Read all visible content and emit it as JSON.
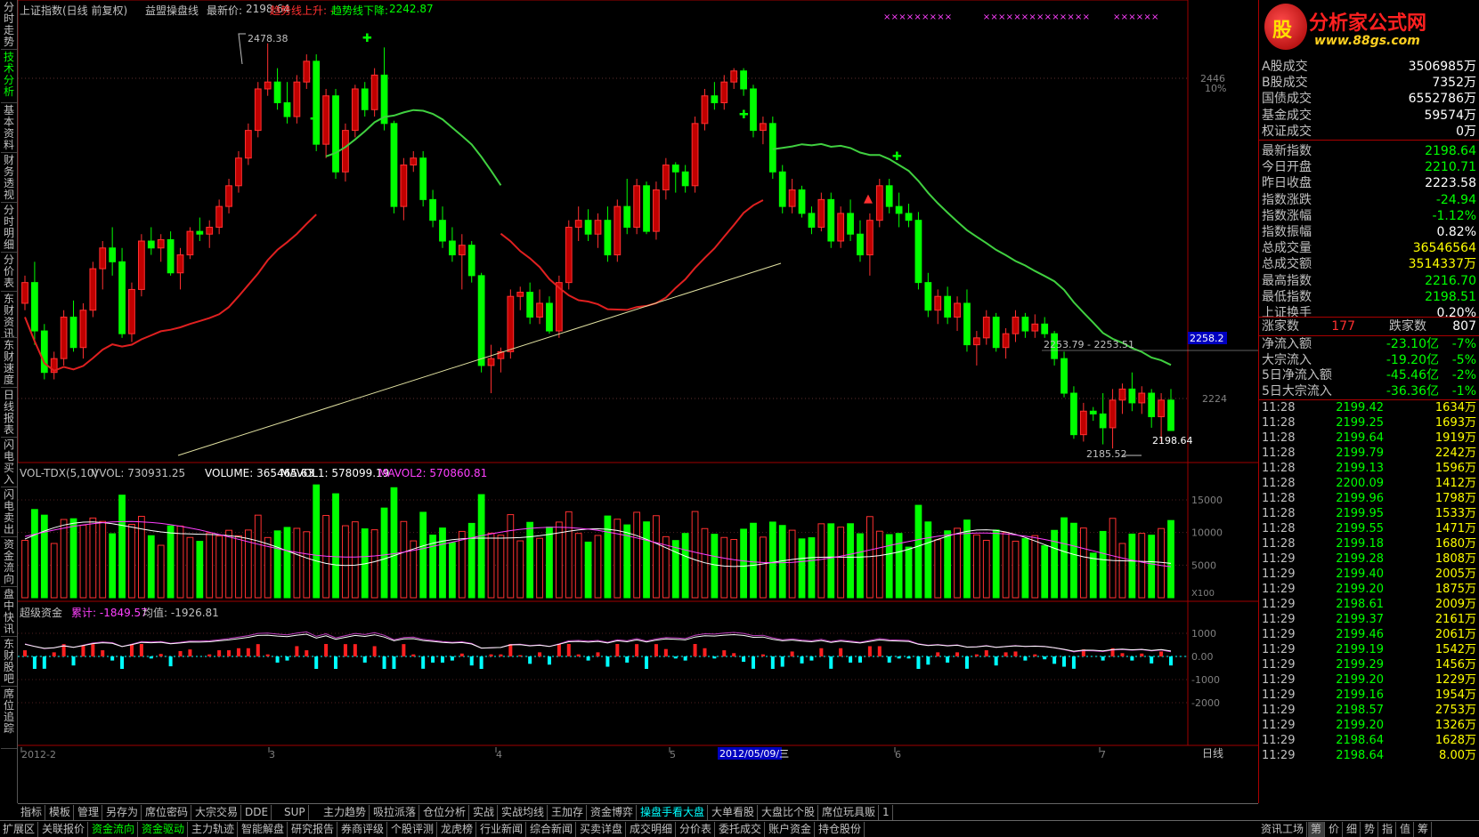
{
  "left_tabs": [
    "分时走势",
    "技术分析",
    "基本资料",
    "财务透视",
    "分时明细",
    "分价表",
    "东财资讯",
    "东财速度",
    "日线报表",
    "闪电买入",
    "闪电卖出",
    "资金流向",
    "盘中快讯",
    "东财股吧",
    "席位追踪"
  ],
  "header": {
    "title": "上证指数(日线 前复权)",
    "indicator": "益盟操盘线",
    "latest_label": "最新价:",
    "latest_value": "2198.64",
    "trend_up_label": "趋势线上升: -",
    "trend_down_label": "趋势线下降:",
    "trend_down_value": "2242.87"
  },
  "price_axis": {
    "high_value": "2446",
    "high_pct": "10%",
    "mid_value": "2224",
    "current_tag": "2258.2"
  },
  "annotations": {
    "high_mark": "2478.38",
    "low_mark": "2185.52",
    "last_price": "2198.64",
    "range_label": "2253.79 - 2253.51"
  },
  "volume_panel": {
    "name": "VOL-TDX(5,10)",
    "vvol": "VVOL: 730931.25",
    "volume": "VOLUME: 365465.63",
    "mavol1": "MAVOL1: 578099.19",
    "mavol2": "MAVOL2: 570860.81",
    "axis": [
      "15000",
      "10000",
      "5000"
    ],
    "unit": "X100"
  },
  "fund_panel": {
    "name": "超级资金",
    "cum_label": "累计: -1849.57",
    "avg_label": "均值: -1926.81",
    "axis": [
      "1000",
      "0.00",
      "-1000",
      "-2000"
    ]
  },
  "x_axis": {
    "labels": [
      "2012-2",
      "3",
      "4",
      "5",
      "6",
      "7"
    ],
    "cursor_date": "2012/05/09/三",
    "period": "日线"
  },
  "stats": [
    {
      "label": "A股成交",
      "value": "3506985万",
      "color": "#ffffff"
    },
    {
      "label": "B股成交",
      "value": "7352万",
      "color": "#ffffff"
    },
    {
      "label": "国债成交",
      "value": "6552786万",
      "color": "#ffffff"
    },
    {
      "label": "基金成交",
      "value": "59574万",
      "color": "#ffffff"
    },
    {
      "label": "权证成交",
      "value": "0万",
      "color": "#ffffff"
    },
    {
      "label": "最新指数",
      "value": "2198.64",
      "color": "#00ff00"
    },
    {
      "label": "今日开盘",
      "value": "2210.71",
      "color": "#00ff00"
    },
    {
      "label": "昨日收盘",
      "value": "2223.58",
      "color": "#ffffff"
    },
    {
      "label": "指数涨跌",
      "value": "-24.94",
      "color": "#00ff00"
    },
    {
      "label": "指数涨幅",
      "value": "-1.12%",
      "color": "#00ff00"
    },
    {
      "label": "指数振幅",
      "value": "0.82%",
      "color": "#ffffff"
    },
    {
      "label": "总成交量",
      "value": "36546564",
      "color": "#ffff00"
    },
    {
      "label": "总成交额",
      "value": "3514337万",
      "color": "#ffff00"
    },
    {
      "label": "最高指数",
      "value": "2216.70",
      "color": "#00ff00"
    },
    {
      "label": "最低指数",
      "value": "2198.51",
      "color": "#00ff00"
    },
    {
      "label": "上证换手",
      "value": "0.20%",
      "color": "#ffffff"
    }
  ],
  "rise_fall": {
    "up_label": "涨家数",
    "up_value": "177",
    "down_label": "跌家数",
    "down_value": "807"
  },
  "flows": [
    {
      "label": "净流入额",
      "value": "-23.10亿",
      "pct": "-7%"
    },
    {
      "label": "大宗流入",
      "value": "-19.20亿",
      "pct": "-5%"
    },
    {
      "label": "5日净流入额",
      "value": "-45.46亿",
      "pct": "-2%"
    },
    {
      "label": "5日大宗流入",
      "value": "-36.36亿",
      "pct": "-1%"
    }
  ],
  "ticks": [
    {
      "time": "11:28",
      "price": "2199.42",
      "vol": "1634万"
    },
    {
      "time": "11:28",
      "price": "2199.25",
      "vol": "1693万"
    },
    {
      "time": "11:28",
      "price": "2199.64",
      "vol": "1919万"
    },
    {
      "time": "11:28",
      "price": "2199.79",
      "vol": "2242万"
    },
    {
      "time": "11:28",
      "price": "2199.13",
      "vol": "1596万"
    },
    {
      "time": "11:28",
      "price": "2200.09",
      "vol": "1412万"
    },
    {
      "time": "11:28",
      "price": "2199.96",
      "vol": "1798万"
    },
    {
      "time": "11:28",
      "price": "2199.95",
      "vol": "1533万"
    },
    {
      "time": "11:28",
      "price": "2199.55",
      "vol": "1471万"
    },
    {
      "time": "11:28",
      "price": "2199.18",
      "vol": "1680万"
    },
    {
      "time": "11:29",
      "price": "2199.28",
      "vol": "1808万"
    },
    {
      "time": "11:29",
      "price": "2199.40",
      "vol": "2005万"
    },
    {
      "time": "11:29",
      "price": "2199.20",
      "vol": "1875万"
    },
    {
      "time": "11:29",
      "price": "2198.61",
      "vol": "2009万"
    },
    {
      "time": "11:29",
      "price": "2199.37",
      "vol": "2161万"
    },
    {
      "time": "11:29",
      "price": "2199.46",
      "vol": "2061万"
    },
    {
      "time": "11:29",
      "price": "2199.19",
      "vol": "1542万"
    },
    {
      "time": "11:29",
      "price": "2199.29",
      "vol": "1456万"
    },
    {
      "time": "11:29",
      "price": "2199.20",
      "vol": "1229万"
    },
    {
      "time": "11:29",
      "price": "2199.16",
      "vol": "1954万"
    },
    {
      "time": "11:29",
      "price": "2198.57",
      "vol": "2753万"
    },
    {
      "time": "11:29",
      "price": "2199.20",
      "vol": "1326万"
    },
    {
      "time": "11:29",
      "price": "2198.64",
      "vol": "1628万"
    },
    {
      "time": "11:29",
      "price": "2198.64",
      "vol": "8.00万"
    }
  ],
  "bottom_tabs_1": [
    "指标",
    "模板",
    "管理",
    "另存为",
    "席位密码",
    "大宗交易",
    "DDE",
    "SUP",
    "主力趋势",
    "吸拉派落",
    "仓位分析",
    "实战",
    "实战均线",
    "王加存",
    "资金博弈",
    "操盘手看大盘",
    "大单看股",
    "大盘比个股",
    "席位玩具贩",
    "1"
  ],
  "bottom_tabs_2": [
    "扩展区",
    "关联报价",
    "资金流向",
    "资金驱动",
    "主力轨迹",
    "智能解盘",
    "研究报告",
    "券商评级",
    "个股评测",
    "龙虎榜",
    "行业新闻",
    "综合新闻",
    "买卖详盘",
    "成交明细",
    "分价表",
    "委托成交",
    "账户资金",
    "持仓股份"
  ],
  "bottom_right_tabs": [
    "资讯工场",
    "第",
    "价",
    "细",
    "势",
    "指",
    "值",
    "筹"
  ],
  "chart_data": {
    "type": "candlestick",
    "title": "上证指数(日线 前复权)",
    "x_start": "2012-02",
    "x_ticks": [
      "2012-2",
      "3",
      "4",
      "5",
      "6",
      "7"
    ],
    "y_unit": "index points",
    "ylim": [
      2180,
      2490
    ],
    "ohlc": [
      [
        2290,
        2310,
        2285,
        2305
      ],
      [
        2305,
        2320,
        2260,
        2270
      ],
      [
        2270,
        2275,
        2235,
        2240
      ],
      [
        2240,
        2255,
        2235,
        2250
      ],
      [
        2250,
        2285,
        2245,
        2280
      ],
      [
        2280,
        2292,
        2255,
        2258
      ],
      [
        2258,
        2290,
        2250,
        2285
      ],
      [
        2285,
        2320,
        2280,
        2315
      ],
      [
        2315,
        2335,
        2300,
        2330
      ],
      [
        2330,
        2345,
        2310,
        2320
      ],
      [
        2320,
        2330,
        2265,
        2268
      ],
      [
        2268,
        2305,
        2262,
        2300
      ],
      [
        2300,
        2340,
        2295,
        2335
      ],
      [
        2335,
        2345,
        2325,
        2330
      ],
      [
        2330,
        2340,
        2320,
        2336
      ],
      [
        2336,
        2342,
        2310,
        2312
      ],
      [
        2312,
        2330,
        2300,
        2325
      ],
      [
        2325,
        2345,
        2322,
        2342
      ],
      [
        2342,
        2352,
        2335,
        2340
      ],
      [
        2340,
        2350,
        2330,
        2345
      ],
      [
        2345,
        2365,
        2340,
        2360
      ],
      [
        2360,
        2380,
        2355,
        2375
      ],
      [
        2375,
        2400,
        2370,
        2395
      ],
      [
        2395,
        2420,
        2390,
        2415
      ],
      [
        2415,
        2450,
        2410,
        2445
      ],
      [
        2445,
        2478,
        2440,
        2450
      ],
      [
        2450,
        2460,
        2430,
        2435
      ],
      [
        2435,
        2450,
        2420,
        2425
      ],
      [
        2425,
        2455,
        2420,
        2450
      ],
      [
        2450,
        2470,
        2445,
        2465
      ],
      [
        2465,
        2470,
        2400,
        2405
      ],
      [
        2405,
        2445,
        2395,
        2440
      ],
      [
        2440,
        2445,
        2380,
        2385
      ],
      [
        2385,
        2420,
        2378,
        2415
      ],
      [
        2415,
        2448,
        2410,
        2445
      ],
      [
        2445,
        2450,
        2425,
        2430
      ],
      [
        2430,
        2460,
        2425,
        2455
      ],
      [
        2455,
        2475,
        2415,
        2420
      ],
      [
        2420,
        2422,
        2355,
        2360
      ],
      [
        2360,
        2395,
        2350,
        2390
      ],
      [
        2390,
        2400,
        2385,
        2395
      ],
      [
        2395,
        2400,
        2360,
        2365
      ],
      [
        2365,
        2372,
        2345,
        2350
      ],
      [
        2350,
        2360,
        2330,
        2335
      ],
      [
        2335,
        2345,
        2320,
        2325
      ],
      [
        2325,
        2340,
        2300,
        2332
      ],
      [
        2332,
        2335,
        2305,
        2310
      ],
      [
        2310,
        2312,
        2240,
        2245
      ],
      [
        2245,
        2260,
        2225,
        2250
      ],
      [
        2250,
        2258,
        2240,
        2255
      ],
      [
        2255,
        2300,
        2250,
        2295
      ],
      [
        2295,
        2302,
        2285,
        2298
      ],
      [
        2298,
        2305,
        2275,
        2280
      ],
      [
        2280,
        2300,
        2275,
        2290
      ],
      [
        2290,
        2295,
        2268,
        2270
      ],
      [
        2270,
        2310,
        2265,
        2305
      ],
      [
        2305,
        2350,
        2300,
        2345
      ],
      [
        2345,
        2360,
        2335,
        2350
      ],
      [
        2350,
        2358,
        2335,
        2340
      ],
      [
        2340,
        2355,
        2330,
        2350
      ],
      [
        2350,
        2360,
        2320,
        2325
      ],
      [
        2325,
        2365,
        2320,
        2360
      ],
      [
        2360,
        2380,
        2340,
        2345
      ],
      [
        2345,
        2380,
        2340,
        2375
      ],
      [
        2375,
        2378,
        2340,
        2342
      ],
      [
        2342,
        2378,
        2336,
        2372
      ],
      [
        2372,
        2395,
        2365,
        2390
      ],
      [
        2390,
        2392,
        2370,
        2385
      ],
      [
        2385,
        2390,
        2370,
        2375
      ],
      [
        2375,
        2425,
        2370,
        2420
      ],
      [
        2420,
        2445,
        2415,
        2440
      ],
      [
        2440,
        2450,
        2430,
        2435
      ],
      [
        2435,
        2455,
        2430,
        2450
      ],
      [
        2450,
        2460,
        2445,
        2458
      ],
      [
        2458,
        2460,
        2440,
        2445
      ],
      [
        2445,
        2448,
        2410,
        2415
      ],
      [
        2415,
        2425,
        2405,
        2420
      ],
      [
        2420,
        2425,
        2380,
        2385
      ],
      [
        2385,
        2390,
        2355,
        2360
      ],
      [
        2360,
        2380,
        2355,
        2372
      ],
      [
        2372,
        2375,
        2352,
        2355
      ],
      [
        2355,
        2360,
        2340,
        2345
      ],
      [
        2345,
        2370,
        2342,
        2365
      ],
      [
        2365,
        2370,
        2330,
        2335
      ],
      [
        2335,
        2360,
        2330,
        2355
      ],
      [
        2355,
        2365,
        2335,
        2340
      ],
      [
        2340,
        2350,
        2320,
        2325
      ],
      [
        2325,
        2355,
        2310,
        2350
      ],
      [
        2350,
        2380,
        2345,
        2375
      ],
      [
        2375,
        2380,
        2355,
        2360
      ],
      [
        2360,
        2370,
        2345,
        2355
      ],
      [
        2355,
        2362,
        2345,
        2350
      ],
      [
        2350,
        2356,
        2300,
        2305
      ],
      [
        2305,
        2312,
        2280,
        2285
      ],
      [
        2285,
        2300,
        2275,
        2295
      ],
      [
        2295,
        2302,
        2275,
        2280
      ],
      [
        2280,
        2295,
        2270,
        2290
      ],
      [
        2290,
        2300,
        2255,
        2260
      ],
      [
        2260,
        2270,
        2245,
        2265
      ],
      [
        2265,
        2285,
        2260,
        2280
      ],
      [
        2280,
        2283,
        2255,
        2258
      ],
      [
        2258,
        2272,
        2250,
        2268
      ],
      [
        2268,
        2285,
        2262,
        2280
      ],
      [
        2280,
        2283,
        2265,
        2270
      ],
      [
        2270,
        2282,
        2265,
        2275
      ],
      [
        2275,
        2280,
        2265,
        2268
      ],
      [
        2268,
        2270,
        2245,
        2250
      ],
      [
        2250,
        2255,
        2222,
        2225
      ],
      [
        2225,
        2230,
        2192,
        2195
      ],
      [
        2195,
        2218,
        2190,
        2212
      ],
      [
        2212,
        2215,
        2205,
        2210
      ],
      [
        2210,
        2225,
        2188,
        2200
      ],
      [
        2200,
        2228,
        2185,
        2220
      ],
      [
        2220,
        2232,
        2210,
        2228
      ],
      [
        2228,
        2240,
        2212,
        2218
      ],
      [
        2218,
        2230,
        2210,
        2225
      ],
      [
        2225,
        2228,
        2200,
        2208
      ],
      [
        2208,
        2225,
        2190,
        2220
      ],
      [
        2220,
        2228,
        2198,
        2198
      ]
    ],
    "series": [
      {
        "name": "MAVOL1",
        "values": [
          578099.19
        ]
      },
      {
        "name": "MAVOL2",
        "values": [
          570860.81
        ]
      }
    ],
    "volume_axis": [
      5000,
      10000,
      15000
    ],
    "fund_axis": [
      -2000,
      -1000,
      0,
      1000
    ]
  }
}
